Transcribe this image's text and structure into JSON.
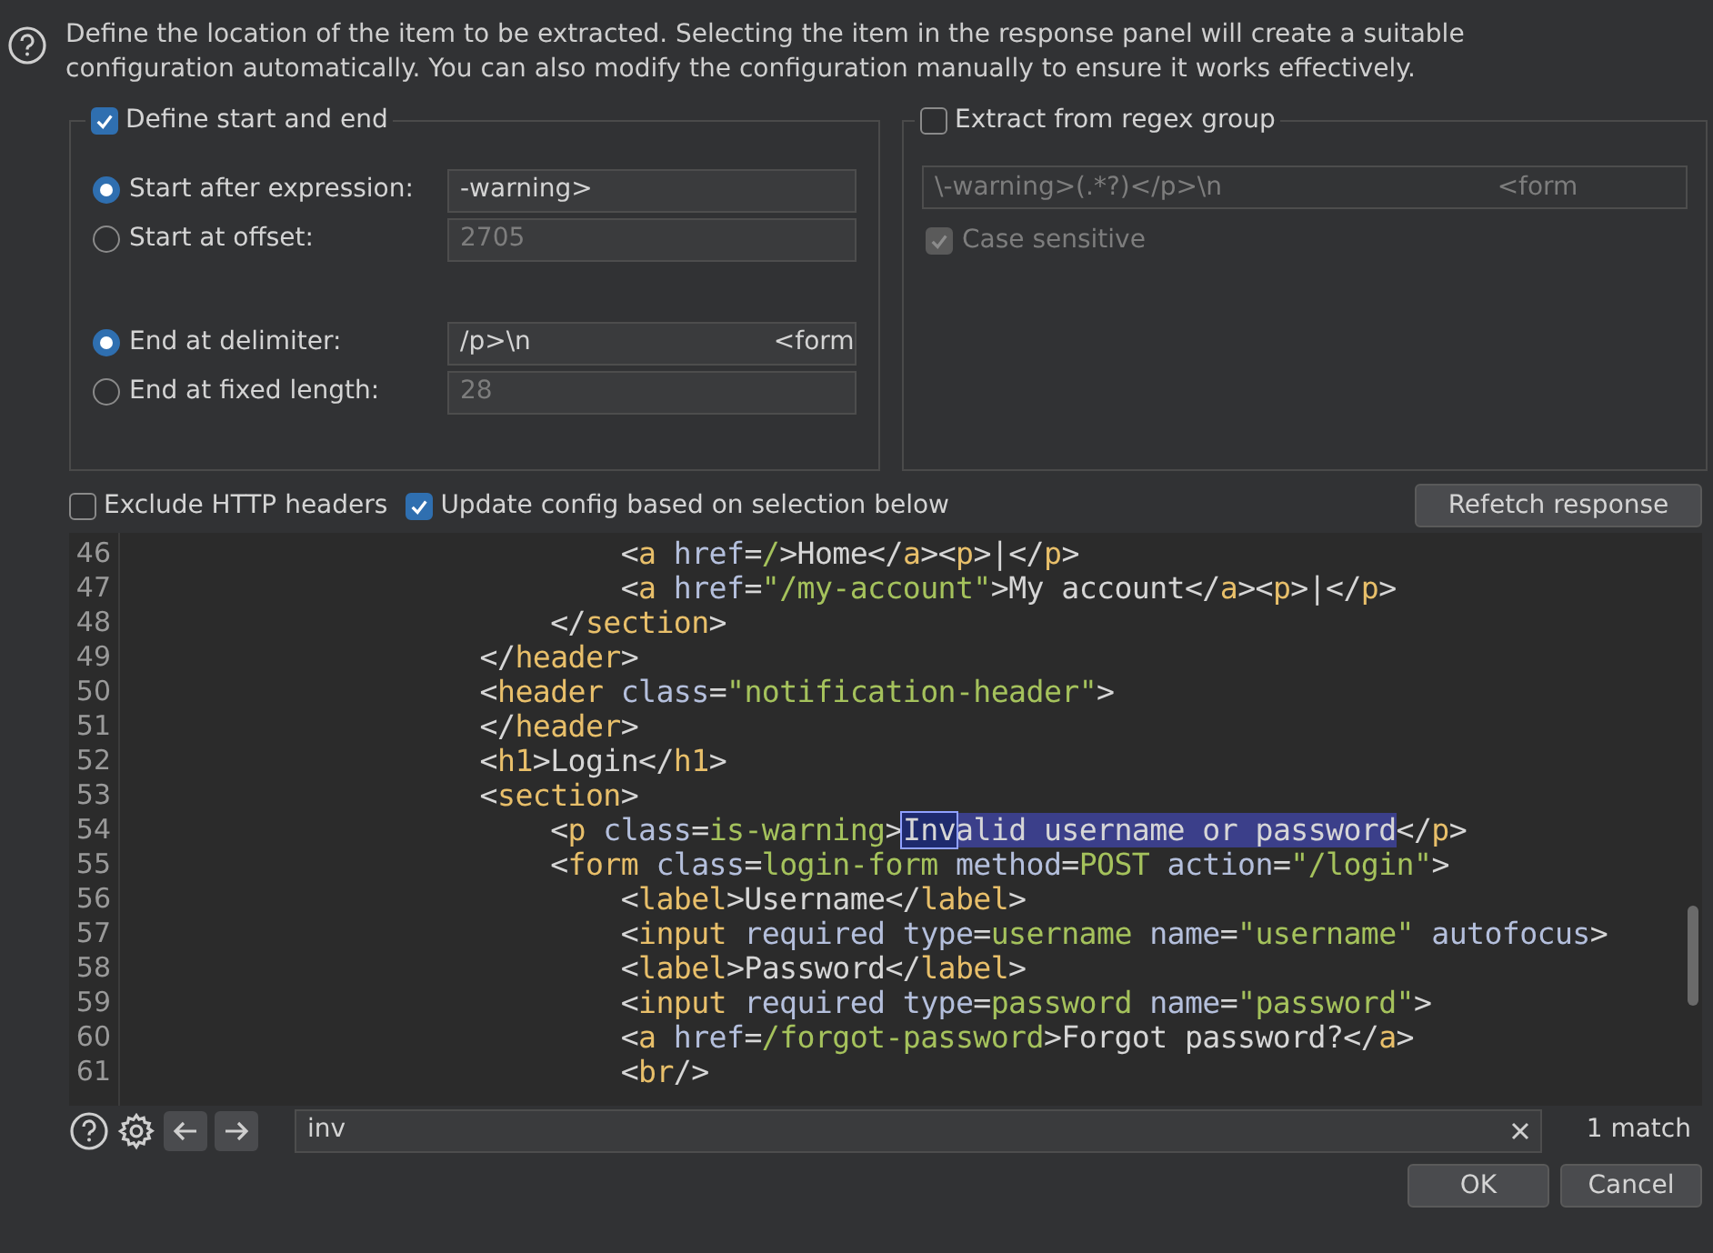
{
  "help_text": "Define the location of the item to be extracted. Selecting the item in the response panel will create a suitable configuration automatically. You can also modify the configuration manually to ensure it works effectively.",
  "start_end_group": {
    "label": "Define start and end",
    "checked": true,
    "start_options": [
      {
        "label": "Start after expression:",
        "selected": true,
        "value": "-warning>",
        "disabled": false
      },
      {
        "label": "Start at offset:",
        "selected": false,
        "value": "2705",
        "disabled": true
      }
    ],
    "end_options": [
      {
        "label": "End at delimiter:",
        "selected": true,
        "value": "/p>\\n                              <form",
        "disabled": false
      },
      {
        "label": "End at fixed length:",
        "selected": false,
        "value": "28",
        "disabled": true
      }
    ]
  },
  "regex_group": {
    "label": "Extract from regex group",
    "checked": false,
    "value": "\\-warning>(.*?)</p>\\n                                  <form",
    "disabled": true,
    "case_sensitive": {
      "label": "Case sensitive",
      "checked": true,
      "disabled": true
    }
  },
  "options": [
    {
      "label": "Exclude HTTP headers",
      "checked": false
    },
    {
      "label": "Update config based on selection below",
      "checked": true
    }
  ],
  "refetch_button": "Refetch response",
  "editor": {
    "lines": [
      {
        "number": "46",
        "tokens": [
          {
            "kind": "punct",
            "text": "                            <"
          },
          {
            "kind": "tag",
            "text": "a"
          },
          {
            "kind": "attr",
            "text": " href"
          },
          {
            "kind": "punct",
            "text": "="
          },
          {
            "kind": "value",
            "text": "/"
          },
          {
            "kind": "punct",
            "text": ">Home</"
          },
          {
            "kind": "tag",
            "text": "a"
          },
          {
            "kind": "punct",
            "text": "><"
          },
          {
            "kind": "tag",
            "text": "p"
          },
          {
            "kind": "punct",
            "text": ">|</"
          },
          {
            "kind": "tag",
            "text": "p"
          },
          {
            "kind": "punct",
            "text": ">"
          }
        ]
      },
      {
        "number": "47",
        "tokens": [
          {
            "kind": "punct",
            "text": "                            <"
          },
          {
            "kind": "tag",
            "text": "a"
          },
          {
            "kind": "attr",
            "text": " href"
          },
          {
            "kind": "punct",
            "text": "="
          },
          {
            "kind": "value",
            "text": "\"/my-account\""
          },
          {
            "kind": "punct",
            "text": ">My account</"
          },
          {
            "kind": "tag",
            "text": "a"
          },
          {
            "kind": "punct",
            "text": "><"
          },
          {
            "kind": "tag",
            "text": "p"
          },
          {
            "kind": "punct",
            "text": ">|</"
          },
          {
            "kind": "tag",
            "text": "p"
          },
          {
            "kind": "punct",
            "text": ">"
          }
        ]
      },
      {
        "number": "48",
        "tokens": [
          {
            "kind": "punct",
            "text": "                        </"
          },
          {
            "kind": "tag",
            "text": "section"
          },
          {
            "kind": "punct",
            "text": ">"
          }
        ]
      },
      {
        "number": "49",
        "tokens": [
          {
            "kind": "punct",
            "text": "                    </"
          },
          {
            "kind": "tag",
            "text": "header"
          },
          {
            "kind": "punct",
            "text": ">"
          }
        ]
      },
      {
        "number": "50",
        "tokens": [
          {
            "kind": "punct",
            "text": "                    <"
          },
          {
            "kind": "tag",
            "text": "header"
          },
          {
            "kind": "attr",
            "text": " class"
          },
          {
            "kind": "punct",
            "text": "="
          },
          {
            "kind": "value",
            "text": "\"notification-header\""
          },
          {
            "kind": "punct",
            "text": ">"
          }
        ]
      },
      {
        "number": "51",
        "tokens": [
          {
            "kind": "punct",
            "text": "                    </"
          },
          {
            "kind": "tag",
            "text": "header"
          },
          {
            "kind": "punct",
            "text": ">"
          }
        ]
      },
      {
        "number": "52",
        "tokens": [
          {
            "kind": "punct",
            "text": "                    <"
          },
          {
            "kind": "tag",
            "text": "h1"
          },
          {
            "kind": "punct",
            "text": ">Login</"
          },
          {
            "kind": "tag",
            "text": "h1"
          },
          {
            "kind": "punct",
            "text": ">"
          }
        ]
      },
      {
        "number": "53",
        "tokens": [
          {
            "kind": "punct",
            "text": "                    <"
          },
          {
            "kind": "tag",
            "text": "section"
          },
          {
            "kind": "punct",
            "text": ">"
          }
        ]
      },
      {
        "number": "54",
        "tokens": [
          {
            "kind": "punct",
            "text": "                        <"
          },
          {
            "kind": "tag",
            "text": "p"
          },
          {
            "kind": "attr",
            "text": " class"
          },
          {
            "kind": "punct",
            "text": "="
          },
          {
            "kind": "value",
            "text": "is-warning"
          },
          {
            "kind": "punct",
            "text": ">"
          },
          {
            "kind": "match",
            "text": "Inv"
          },
          {
            "kind": "selection",
            "text": "alid username or password"
          },
          {
            "kind": "punct",
            "text": "</"
          },
          {
            "kind": "tag",
            "text": "p"
          },
          {
            "kind": "punct",
            "text": ">"
          }
        ]
      },
      {
        "number": "55",
        "tokens": [
          {
            "kind": "punct",
            "text": "                        <"
          },
          {
            "kind": "tag",
            "text": "form"
          },
          {
            "kind": "attr",
            "text": " class"
          },
          {
            "kind": "punct",
            "text": "="
          },
          {
            "kind": "value",
            "text": "login-form"
          },
          {
            "kind": "attr",
            "text": " method"
          },
          {
            "kind": "punct",
            "text": "="
          },
          {
            "kind": "value",
            "text": "POST"
          },
          {
            "kind": "attr",
            "text": " action"
          },
          {
            "kind": "punct",
            "text": "="
          },
          {
            "kind": "value",
            "text": "\"/login\""
          },
          {
            "kind": "punct",
            "text": ">"
          }
        ]
      },
      {
        "number": "56",
        "tokens": [
          {
            "kind": "punct",
            "text": "                            <"
          },
          {
            "kind": "tag",
            "text": "label"
          },
          {
            "kind": "punct",
            "text": ">Username</"
          },
          {
            "kind": "tag",
            "text": "label"
          },
          {
            "kind": "punct",
            "text": ">"
          }
        ]
      },
      {
        "number": "57",
        "tokens": [
          {
            "kind": "punct",
            "text": "                            <"
          },
          {
            "kind": "tag",
            "text": "input"
          },
          {
            "kind": "attr",
            "text": " required type"
          },
          {
            "kind": "punct",
            "text": "="
          },
          {
            "kind": "value",
            "text": "username"
          },
          {
            "kind": "attr",
            "text": " name"
          },
          {
            "kind": "punct",
            "text": "="
          },
          {
            "kind": "value",
            "text": "\"username\""
          },
          {
            "kind": "attr",
            "text": " autofocus"
          },
          {
            "kind": "punct",
            "text": ">"
          }
        ]
      },
      {
        "number": "58",
        "tokens": [
          {
            "kind": "punct",
            "text": "                            <"
          },
          {
            "kind": "tag",
            "text": "label"
          },
          {
            "kind": "punct",
            "text": ">Password</"
          },
          {
            "kind": "tag",
            "text": "label"
          },
          {
            "kind": "punct",
            "text": ">"
          }
        ]
      },
      {
        "number": "59",
        "tokens": [
          {
            "kind": "punct",
            "text": "                            <"
          },
          {
            "kind": "tag",
            "text": "input"
          },
          {
            "kind": "attr",
            "text": " required type"
          },
          {
            "kind": "punct",
            "text": "="
          },
          {
            "kind": "value",
            "text": "password"
          },
          {
            "kind": "attr",
            "text": " name"
          },
          {
            "kind": "punct",
            "text": "="
          },
          {
            "kind": "value",
            "text": "\"password\""
          },
          {
            "kind": "punct",
            "text": ">"
          }
        ]
      },
      {
        "number": "60",
        "tokens": [
          {
            "kind": "punct",
            "text": "                            <"
          },
          {
            "kind": "tag",
            "text": "a"
          },
          {
            "kind": "attr",
            "text": " href"
          },
          {
            "kind": "punct",
            "text": "="
          },
          {
            "kind": "value",
            "text": "/forgot-password"
          },
          {
            "kind": "punct",
            "text": ">Forgot password?</"
          },
          {
            "kind": "tag",
            "text": "a"
          },
          {
            "kind": "punct",
            "text": ">"
          }
        ]
      },
      {
        "number": "61",
        "tokens": [
          {
            "kind": "punct",
            "text": "                            <"
          },
          {
            "kind": "tag",
            "text": "br"
          },
          {
            "kind": "punct",
            "text": "/>"
          }
        ]
      }
    ]
  },
  "search": {
    "value": "inv",
    "match_count": "1 match"
  },
  "buttons": [
    "OK",
    "Cancel"
  ]
}
